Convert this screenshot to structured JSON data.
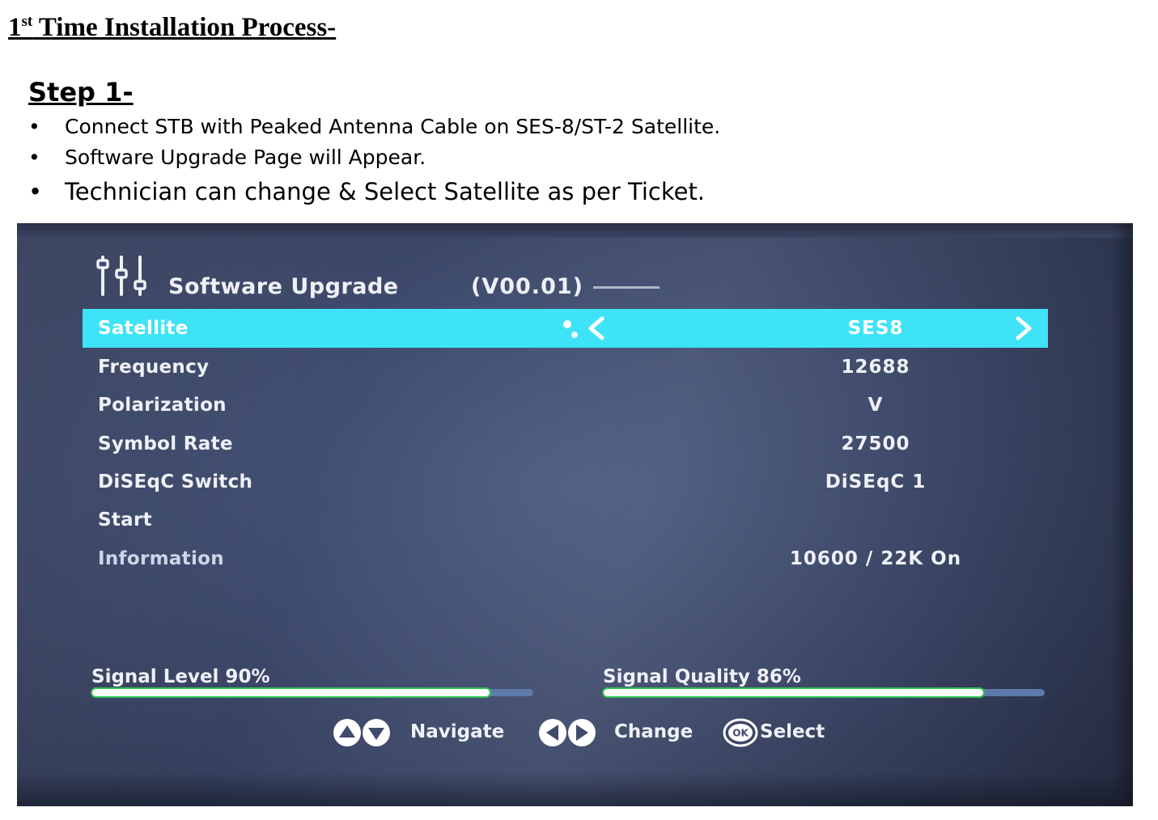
{
  "doc": {
    "title_num": "1",
    "title_sup": "st",
    "title_rest": " Time Installation Process-",
    "step_heading": "Step 1-",
    "bullets": [
      "Connect STB with Peaked Antenna Cable on SES-8/ST-2 Satellite.",
      "Software Upgrade Page will Appear.",
      "Technician can change & Select Satellite as per Ticket."
    ],
    "bullet_char": "•"
  },
  "tv": {
    "menu_title": "Software Upgrade",
    "version": "(V00.01)",
    "rows": [
      {
        "label": "Satellite",
        "value": "SES8"
      },
      {
        "label": "Frequency",
        "value": "12688"
      },
      {
        "label": "Polarization",
        "value": "V"
      },
      {
        "label": "Symbol Rate",
        "value": "27500"
      },
      {
        "label": "DiSEqC Switch",
        "value": "DiSEqC 1"
      },
      {
        "label": "Start",
        "value": ""
      },
      {
        "label": "Information",
        "value": "10600 / 22K On"
      }
    ],
    "signal_level": {
      "label": "Signal Level 90%",
      "fraction": 0.9
    },
    "signal_quality": {
      "label": "Signal Quality 86%",
      "fraction": 0.86
    },
    "legend": {
      "navigate": "Navigate",
      "change": "Change",
      "ok": "OK",
      "select": "Select"
    },
    "colors": {
      "highlight": "#3ee3f7",
      "screen_bg": "#3f4b6d",
      "bar_track": "#5d7aa8",
      "bar_outline": "#2fbf55"
    }
  }
}
